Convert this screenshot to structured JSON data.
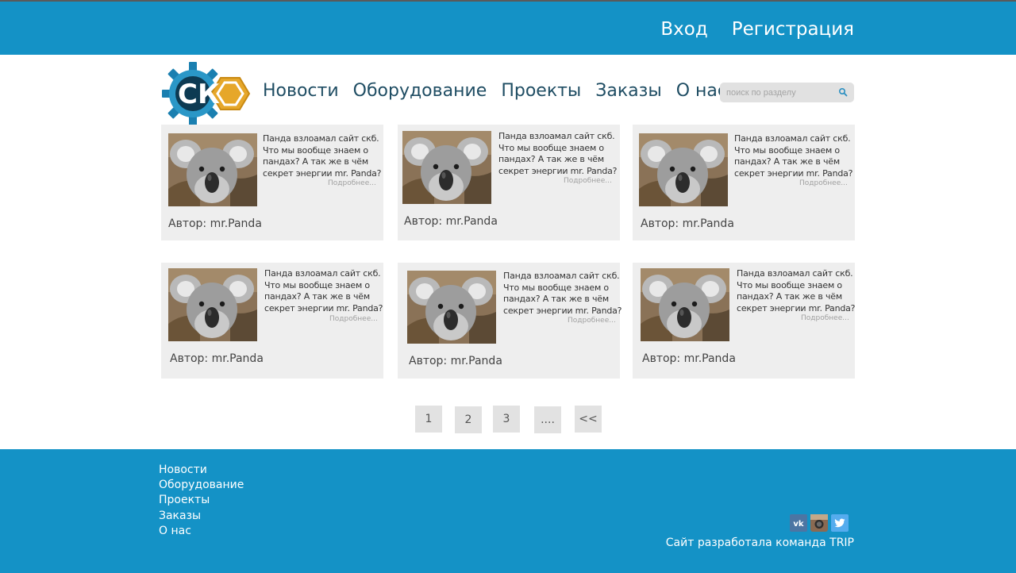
{
  "topbar": {
    "login_label": "Вход",
    "register_label": "Регистрация"
  },
  "logo": {
    "letters": "СК"
  },
  "nav": {
    "items": [
      {
        "label": "Новости"
      },
      {
        "label": "Оборудование"
      },
      {
        "label": "Проекты"
      },
      {
        "label": "Заказы"
      },
      {
        "label": "О нас"
      }
    ]
  },
  "search": {
    "placeholder": "поиск по разделу",
    "icon": "search-icon"
  },
  "colors": {
    "accent": "#1492c6",
    "nav_text": "#1f4d63",
    "card_bg": "#eeeeee",
    "logo_gear": "#1a7fb0",
    "logo_hex": "#e6a72a"
  },
  "cards": [
    {
      "text": "Панда взлоамал сайт скб. Что мы вообще знаем о пандах? А так же в чём секрет энергии mr. Panda?",
      "more": "Подробнее...",
      "author": "Автор: mr.Panda"
    },
    {
      "text": "Панда взлоамал сайт скб. Что мы вообще знаем о пандах? А так же в чём секрет энергии mr. Panda?",
      "more": "Подробнее...",
      "author": "Автор: mr.Panda"
    },
    {
      "text": "Панда взлоамал сайт скб. Что мы вообще знаем о пандах? А так же в чём секрет энергии mr. Panda?",
      "more": "Подробнее...",
      "author": "Автор: mr.Panda"
    },
    {
      "text": "Панда взлоамал сайт скб. Что мы вообще знаем о пандах? А так же в чём секрет энергии mr. Panda?",
      "more": "Подробнее...",
      "author": "Автор: mr.Panda"
    },
    {
      "text": "Панда взлоамал сайт скб. Что мы вообще знаем о пандах? А так же в чём секрет энергии mr. Panda?",
      "more": "Подробнее...",
      "author": "Автор: mr.Panda"
    },
    {
      "text": "Панда взлоамал сайт скб. Что мы вообще знаем о пандах? А так же в чём секрет энергии mr. Panda?",
      "more": "Подробнее...",
      "author": "Автор: mr.Panda"
    }
  ],
  "pagination": {
    "pages": [
      "1",
      "2",
      "3",
      "....",
      "<<"
    ]
  },
  "footer": {
    "links": [
      {
        "label": "Новости"
      },
      {
        "label": "Оборудование"
      },
      {
        "label": "Проекты"
      },
      {
        "label": "Заказы"
      },
      {
        "label": "О нас"
      }
    ],
    "social": [
      {
        "name": "vk",
        "text": "vk"
      },
      {
        "name": "instagram"
      },
      {
        "name": "twitter"
      }
    ],
    "credit": "Сайт разработала команда TRIP"
  }
}
